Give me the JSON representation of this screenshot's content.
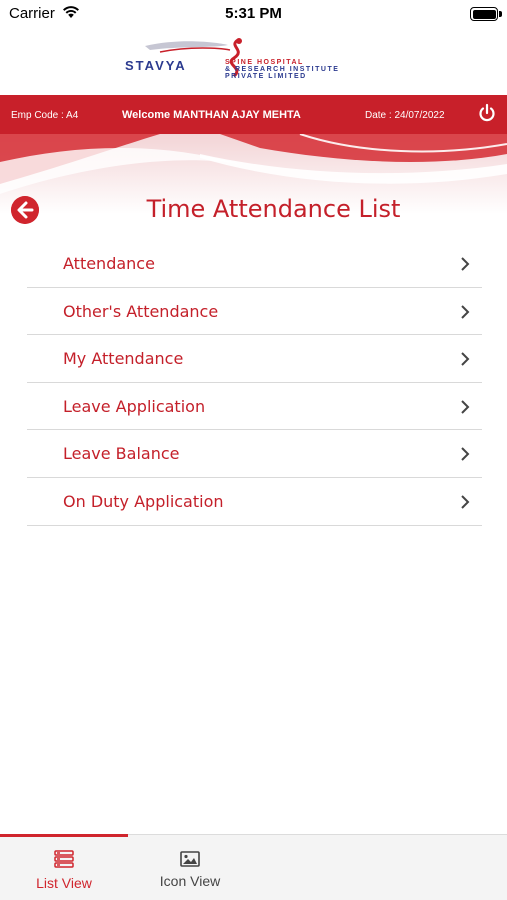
{
  "status_bar": {
    "carrier": "Carrier",
    "time": "5:31 PM"
  },
  "logo": {
    "brand": "STAVYA",
    "line1": "SPINE HOSPITAL",
    "line2": "& RESEARCH INSTITUTE",
    "line3": "PRIVATE LIMITED"
  },
  "header": {
    "emp_code": "Emp Code : A4",
    "welcome": "Welcome MANTHAN AJAY MEHTA",
    "date": "Date : 24/07/2022"
  },
  "page": {
    "title": "Time Attendance List"
  },
  "menu": {
    "items": [
      {
        "label": "Attendance"
      },
      {
        "label": "Other's Attendance"
      },
      {
        "label": "My Attendance"
      },
      {
        "label": "Leave Application"
      },
      {
        "label": "Leave Balance"
      },
      {
        "label": "On Duty Application"
      }
    ]
  },
  "tab_bar": {
    "tabs": [
      {
        "label": "List View",
        "icon": "list-icon",
        "selected": true
      },
      {
        "label": "Icon View",
        "icon": "image-icon",
        "selected": false
      }
    ]
  },
  "colors": {
    "accent": "#c8202a",
    "divider": "#d9d9d9",
    "tab_bar_bg": "#f4f4f4"
  }
}
